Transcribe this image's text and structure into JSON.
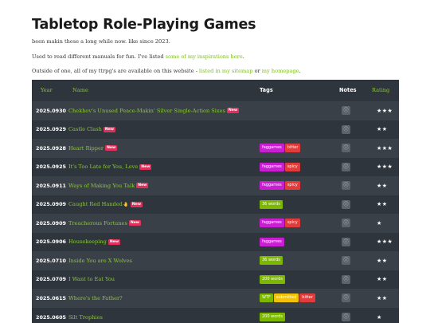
{
  "page": {
    "title": "Tabletop Role-Playing Games",
    "line1": "been makin these a long while now. like since 2023.",
    "line2_pre": "Used to read different manuals for fun. I've listed ",
    "line2_link": "some of my inspirations here",
    "line2_post": ".",
    "line3_pre": "Outside of one, all of my ttrpg's are available on this website - ",
    "line3_link1": "listed in my sitemap",
    "line3_mid": " or ",
    "line3_link2": "my homepage",
    "line3_post": "."
  },
  "table": {
    "headers": {
      "year": "Year",
      "name": "Name",
      "tags": "Tags",
      "notes": "Notes",
      "rating": "Rating"
    },
    "new_label": "New",
    "info_icon": "ⓘ",
    "tag_colors": {
      "faggames": "#c71fd1",
      "bitter": "#e03c3c",
      "spicy": "#e03c3c",
      "words": "#7db800",
      "WTF": "#7db800",
      "submitted": "#f0c20a"
    },
    "rows": [
      {
        "year": "2025.0930",
        "name": "Chekhov's Unused Peace-Makin' Silver Single-Action Sixes",
        "new": true,
        "emoji": "",
        "tags": [],
        "rating": "★★★"
      },
      {
        "year": "2025.0929",
        "name": "Castle Clash",
        "new": true,
        "emoji": "",
        "tags": [],
        "rating": "★★"
      },
      {
        "year": "2025.0928",
        "name": "Heart Ripper",
        "new": true,
        "emoji": "",
        "tags": [
          {
            "text": "faggames",
            "color": "faggames"
          },
          {
            "text": "bitter",
            "color": "bitter"
          }
        ],
        "rating": "★★★"
      },
      {
        "year": "2025.0925",
        "name": "It's Too Late for You, Love",
        "new": true,
        "emoji": "",
        "tags": [
          {
            "text": "faggames",
            "color": "faggames"
          },
          {
            "text": "spicy",
            "color": "spicy"
          }
        ],
        "rating": "★★★"
      },
      {
        "year": "2025.0911",
        "name": "Ways of Making You Talk",
        "new": true,
        "emoji": "",
        "tags": [
          {
            "text": "faggames",
            "color": "faggames"
          },
          {
            "text": "spicy",
            "color": "spicy"
          }
        ],
        "rating": "★★"
      },
      {
        "year": "2025.0909",
        "name": "Caught Red Handed",
        "new": true,
        "emoji": "🤚",
        "tags": [
          {
            "text": "36 words",
            "color": "words"
          }
        ],
        "rating": "★★"
      },
      {
        "year": "2025.0909",
        "name": "Treacherous Fortunes",
        "new": true,
        "emoji": "",
        "tags": [
          {
            "text": "faggames",
            "color": "faggames"
          },
          {
            "text": "spicy",
            "color": "spicy"
          }
        ],
        "rating": "★"
      },
      {
        "year": "2025.0906",
        "name": "Housekeeping",
        "new": true,
        "emoji": "",
        "tags": [
          {
            "text": "faggames",
            "color": "faggames"
          }
        ],
        "rating": "★★★"
      },
      {
        "year": "2025.0710",
        "name": "Inside You are X Wolves",
        "new": false,
        "emoji": "",
        "tags": [
          {
            "text": "36 words",
            "color": "words"
          }
        ],
        "rating": "★★"
      },
      {
        "year": "2025.0709",
        "name": "I Want to Eat You",
        "new": false,
        "emoji": "",
        "tags": [
          {
            "text": "200 words",
            "color": "words"
          }
        ],
        "rating": "★★"
      },
      {
        "year": "2025.0615",
        "name": "Where's the Father?",
        "new": false,
        "emoji": "",
        "tags": [
          {
            "text": "WTF",
            "color": "WTF"
          },
          {
            "text": "submitted",
            "color": "submitted"
          },
          {
            "text": "bitter",
            "color": "bitter"
          }
        ],
        "rating": "★★"
      },
      {
        "year": "2025.0605",
        "name": "Silt Trophies",
        "new": false,
        "emoji": "",
        "tags": [
          {
            "text": "200 words",
            "color": "words"
          }
        ],
        "rating": "★"
      }
    ]
  }
}
